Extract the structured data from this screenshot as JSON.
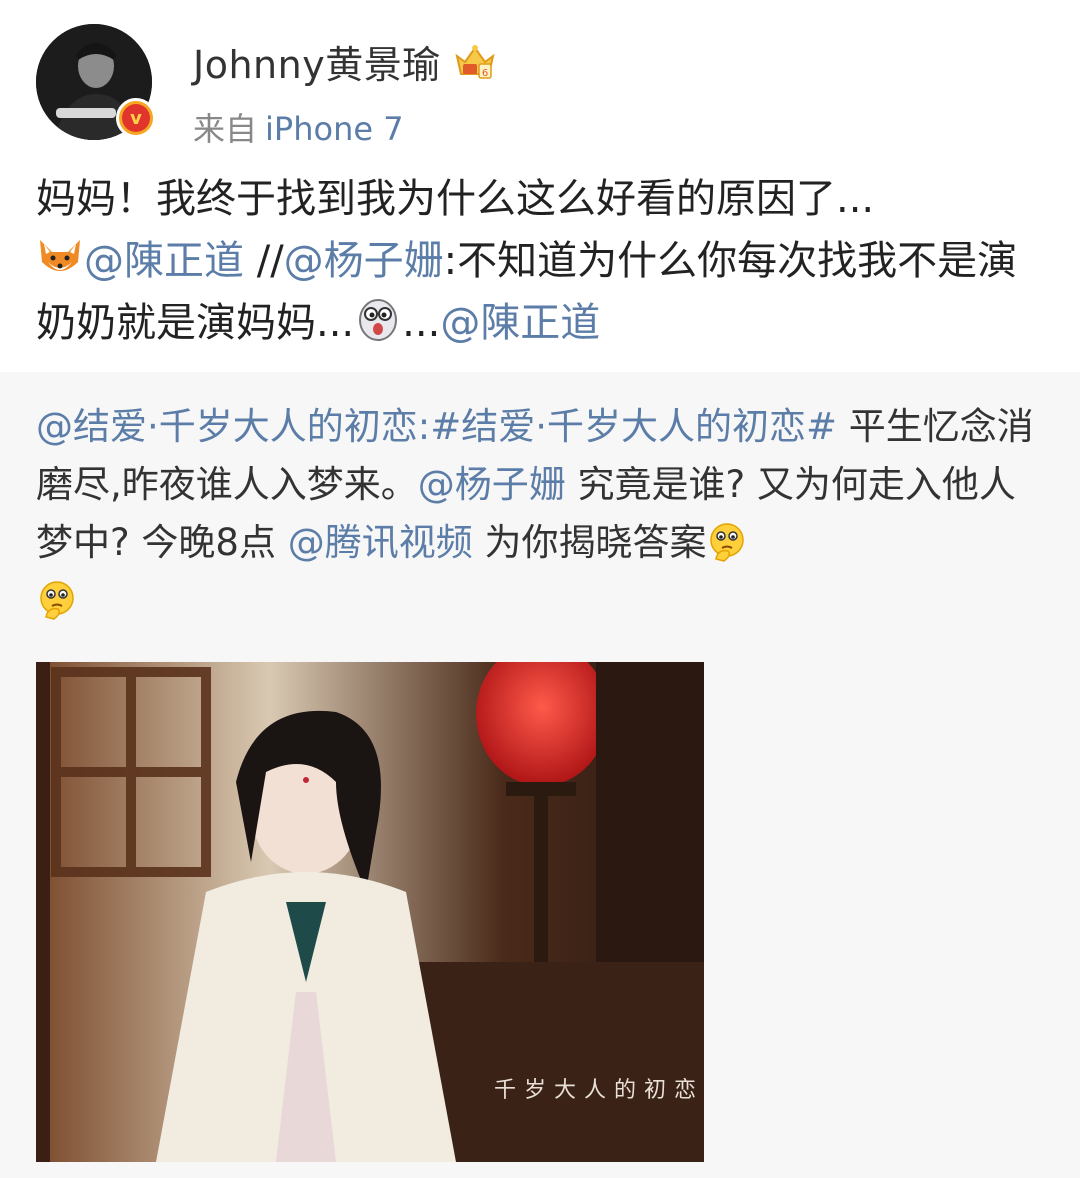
{
  "header": {
    "username": "Johnny黄景瑜",
    "source_prefix": "来自",
    "source_device": "iPhone 7",
    "verified_mark": "v"
  },
  "post": {
    "line1": "妈妈！我终于找到我为什么这么好看的原因了...",
    "mention1": "@陳正道",
    "separator": " //",
    "mention2": "@杨子姗",
    "quote_text": ":不知道为什么你每次找我不是演奶奶就是演妈妈...",
    "ellipsis": "...",
    "mention3": "@陳正道"
  },
  "repost": {
    "author_mention": "@结爱·千岁大人的初恋",
    "hashtag": ":#结爱·千岁大人的初恋#",
    "text1": " 平生忆念消磨尽,昨夜谁人入梦来。",
    "mention_actor": "@杨子姗",
    "text2": " 究竟是谁? 又为何走入他人梦中? 今晚8点 ",
    "mention_platform": "@腾讯视频",
    "text3": " 为你揭晓答案",
    "image_caption": "千岁大人的初恋"
  },
  "icons": {
    "vip": "vip-crown-icon",
    "fox": "fox-emoji-icon",
    "shocked": "shocked-emoji-icon",
    "thinking": "thinking-emoji-icon"
  },
  "colors": {
    "link": "#5b7da8",
    "badge_red": "#e0342c",
    "badge_gold": "#f5a623",
    "repost_bg": "#f7f7f7"
  }
}
